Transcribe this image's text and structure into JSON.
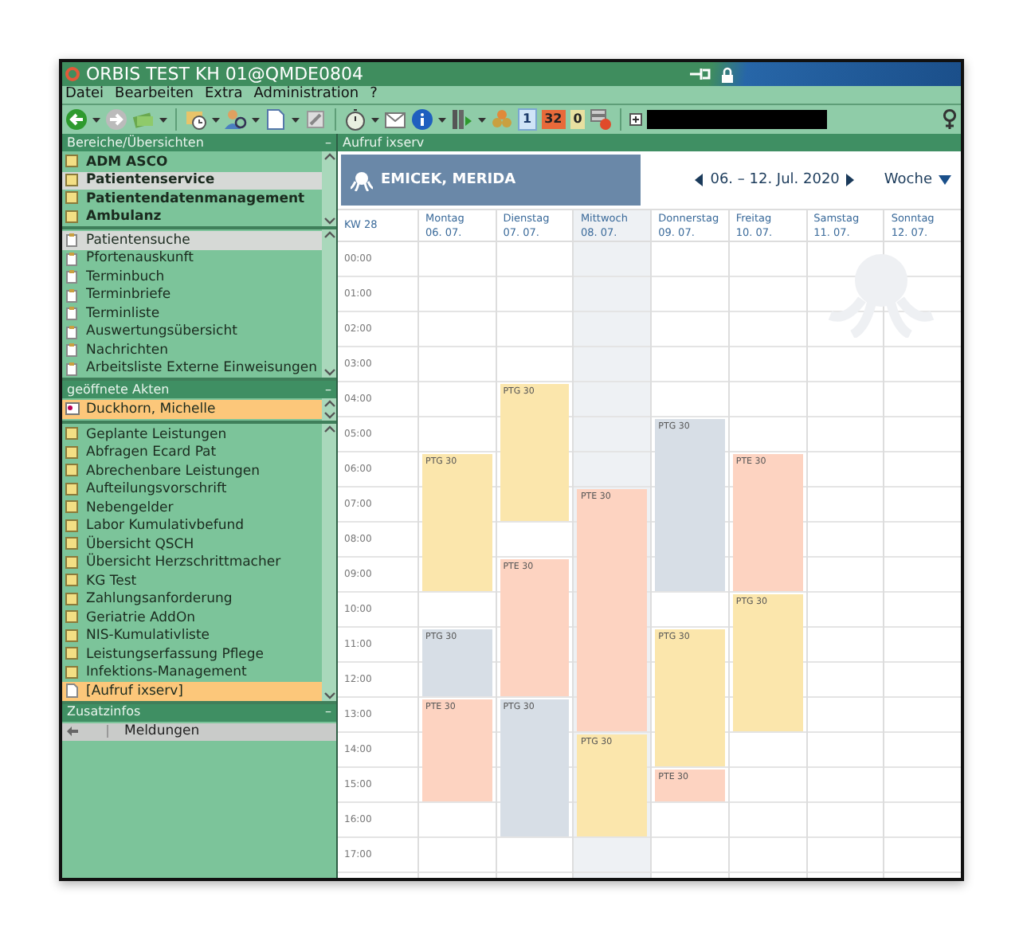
{
  "window": {
    "title": "ORBIS TEST KH 01@QMDE0804"
  },
  "menu": [
    "Datei",
    "Bearbeiten",
    "Extra",
    "Administration",
    "?"
  ],
  "toolbar": {
    "day_badge": "1",
    "date_badge": "32",
    "count_badge": "0"
  },
  "left_panel": {
    "title": "Bereiche/Übersichten",
    "collapse": "–",
    "areas": [
      {
        "label": "ADM ASCO",
        "selected": false
      },
      {
        "label": "Patientenservice",
        "selected": true
      },
      {
        "label": "Patientendatenmanagement",
        "selected": false
      },
      {
        "label": "Ambulanz",
        "selected": false
      }
    ],
    "functions": [
      {
        "label": "Patientensuche",
        "selected": true
      },
      {
        "label": "Pfortenauskunft",
        "selected": false
      },
      {
        "label": "Terminbuch",
        "selected": false
      },
      {
        "label": "Terminbriefe",
        "selected": false
      },
      {
        "label": "Terminliste",
        "selected": false
      },
      {
        "label": "Auswertungsübersicht",
        "selected": false
      },
      {
        "label": "Nachrichten",
        "selected": false
      },
      {
        "label": "Arbeitsliste Externe Einweisungen",
        "selected": false
      }
    ],
    "open_files": {
      "title": "geöffnete Akten",
      "collapse": "–",
      "items": [
        {
          "label": "Duckhorn, Michelle",
          "selected": true
        }
      ]
    },
    "file_functions": [
      {
        "label": "Geplante Leistungen",
        "kind": "folder",
        "selected": false
      },
      {
        "label": "Abfragen Ecard Pat",
        "kind": "folder",
        "selected": false
      },
      {
        "label": "Abrechenbare Leistungen",
        "kind": "folder",
        "selected": false
      },
      {
        "label": "Aufteilungsvorschrift",
        "kind": "folder",
        "selected": false
      },
      {
        "label": "Nebengelder",
        "kind": "folder",
        "selected": false
      },
      {
        "label": "Labor Kumulativbefund",
        "kind": "folder",
        "selected": false
      },
      {
        "label": "Übersicht QSCH",
        "kind": "folder",
        "selected": false
      },
      {
        "label": "Übersicht Herzschrittmacher",
        "kind": "folder",
        "selected": false
      },
      {
        "label": "KG Test",
        "kind": "folder",
        "selected": false
      },
      {
        "label": "Zahlungsanforderung",
        "kind": "folder",
        "selected": false
      },
      {
        "label": "Geriatrie AddOn",
        "kind": "folder",
        "selected": false
      },
      {
        "label": "NIS-Kumulativliste",
        "kind": "folder",
        "selected": false
      },
      {
        "label": "Leistungserfassung Pflege",
        "kind": "folder",
        "selected": false
      },
      {
        "label": "Infektions-Management",
        "kind": "folder",
        "selected": false
      },
      {
        "label": "[Aufruf ixserv]",
        "kind": "page",
        "selected": true
      }
    ],
    "extra_info": {
      "title": "Zusatzinfos",
      "collapse": "–",
      "columns": [
        "Meldungen"
      ]
    }
  },
  "content": {
    "title": "Aufruf ixserv",
    "calendar": {
      "patient": "EMICEK, MERIDA",
      "range": "06. – 12. Jul. 2020",
      "view": "Woche",
      "week": "KW 28",
      "hours": [
        "00:00",
        "01:00",
        "02:00",
        "03:00",
        "04:00",
        "05:00",
        "06:00",
        "07:00",
        "08:00",
        "09:00",
        "10:00",
        "11:00",
        "12:00",
        "13:00",
        "14:00",
        "15:00",
        "16:00",
        "17:00"
      ],
      "days": [
        {
          "name": "Montag",
          "date": "06. 07.",
          "selected": false,
          "slots": [
            {
              "kind": "free"
            },
            {
              "kind": "free"
            },
            {
              "kind": "free"
            },
            {
              "kind": "free"
            },
            {
              "kind": "free"
            },
            {
              "kind": "free"
            },
            {
              "kind": "start",
              "label": "PTG 30",
              "color": "#fbe6ac"
            },
            {
              "kind": "continue"
            },
            {
              "kind": "continue"
            },
            {
              "kind": "continue"
            },
            {
              "kind": "free"
            },
            {
              "kind": "start",
              "label": "PTG 30",
              "color": "#d7dee6"
            },
            {
              "kind": "continue"
            },
            {
              "kind": "start",
              "label": "PTE 30",
              "color": "#fdd3c1"
            },
            {
              "kind": "continue"
            },
            {
              "kind": "continue"
            },
            {
              "kind": "free"
            },
            {
              "kind": "free"
            }
          ]
        },
        {
          "name": "Dienstag",
          "date": "07. 07.",
          "selected": false,
          "slots": [
            {
              "kind": "free"
            },
            {
              "kind": "free"
            },
            {
              "kind": "free"
            },
            {
              "kind": "free"
            },
            {
              "kind": "start",
              "label": "PTG 30",
              "color": "#fbe6ac"
            },
            {
              "kind": "continue"
            },
            {
              "kind": "continue"
            },
            {
              "kind": "continue"
            },
            {
              "kind": "free"
            },
            {
              "kind": "start",
              "label": "PTE 30",
              "color": "#fdd3c1"
            },
            {
              "kind": "continue"
            },
            {
              "kind": "continue"
            },
            {
              "kind": "continue"
            },
            {
              "kind": "start",
              "label": "PTG 30",
              "color": "#d7dee6"
            },
            {
              "kind": "continue"
            },
            {
              "kind": "continue"
            },
            {
              "kind": "continue"
            },
            {
              "kind": "free"
            }
          ]
        },
        {
          "name": "Mittwoch",
          "date": "08. 07.",
          "selected": true,
          "slots": [
            {
              "kind": "free"
            },
            {
              "kind": "free"
            },
            {
              "kind": "free"
            },
            {
              "kind": "free"
            },
            {
              "kind": "free"
            },
            {
              "kind": "free"
            },
            {
              "kind": "free"
            },
            {
              "kind": "start",
              "label": "PTE 30",
              "color": "#fdd3c1"
            },
            {
              "kind": "continue"
            },
            {
              "kind": "continue"
            },
            {
              "kind": "continue"
            },
            {
              "kind": "continue"
            },
            {
              "kind": "continue"
            },
            {
              "kind": "continue"
            },
            {
              "kind": "start",
              "label": "PTG 30",
              "color": "#fbe6ac"
            },
            {
              "kind": "continue"
            },
            {
              "kind": "continue"
            },
            {
              "kind": "free"
            }
          ]
        },
        {
          "name": "Donnerstag",
          "date": "09. 07.",
          "selected": false,
          "slots": [
            {
              "kind": "free"
            },
            {
              "kind": "free"
            },
            {
              "kind": "free"
            },
            {
              "kind": "free"
            },
            {
              "kind": "free"
            },
            {
              "kind": "start",
              "label": "PTG 30",
              "color": "#d7dee6"
            },
            {
              "kind": "continue"
            },
            {
              "kind": "continue"
            },
            {
              "kind": "continue"
            },
            {
              "kind": "continue"
            },
            {
              "kind": "free"
            },
            {
              "kind": "start",
              "label": "PTG 30",
              "color": "#fbe6ac"
            },
            {
              "kind": "continue"
            },
            {
              "kind": "continue"
            },
            {
              "kind": "continue"
            },
            {
              "kind": "start",
              "label": "PTE 30",
              "color": "#fdd3c1"
            },
            {
              "kind": "free"
            },
            {
              "kind": "free"
            }
          ]
        },
        {
          "name": "Freitag",
          "date": "10. 07.",
          "selected": false,
          "slots": [
            {
              "kind": "free"
            },
            {
              "kind": "free"
            },
            {
              "kind": "free"
            },
            {
              "kind": "free"
            },
            {
              "kind": "free"
            },
            {
              "kind": "free"
            },
            {
              "kind": "start",
              "label": "PTE 30",
              "color": "#fdd3c1"
            },
            {
              "kind": "continue"
            },
            {
              "kind": "continue"
            },
            {
              "kind": "continue"
            },
            {
              "kind": "start",
              "label": "PTG 30",
              "color": "#fbe6ac"
            },
            {
              "kind": "continue"
            },
            {
              "kind": "continue"
            },
            {
              "kind": "continue"
            },
            {
              "kind": "free"
            },
            {
              "kind": "free"
            },
            {
              "kind": "free"
            },
            {
              "kind": "free"
            }
          ]
        },
        {
          "name": "Samstag",
          "date": "11. 07.",
          "selected": false
        },
        {
          "name": "Sonntag",
          "date": "12. 07.",
          "selected": false
        }
      ]
    }
  }
}
